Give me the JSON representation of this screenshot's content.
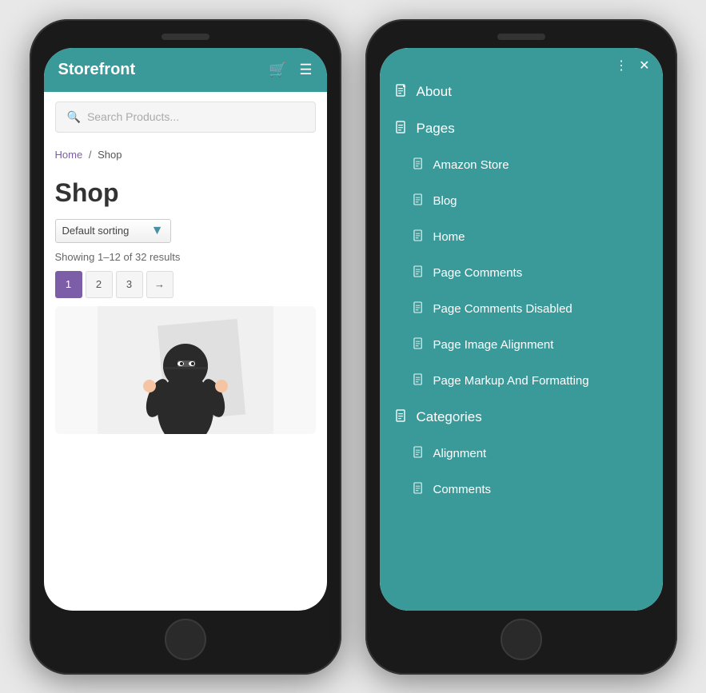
{
  "left_phone": {
    "header": {
      "logo": "Storefront",
      "cart_icon": "🛒",
      "menu_icon": "☰"
    },
    "search": {
      "placeholder": "Search Products..."
    },
    "breadcrumb": {
      "home": "Home",
      "separator": "/",
      "current": "Shop"
    },
    "shop": {
      "title": "Shop",
      "sort_label": "Default sorting",
      "results_text": "Showing 1–12 of 32 results",
      "pages": [
        "1",
        "2",
        "3",
        "→"
      ]
    }
  },
  "right_phone": {
    "top_items": [
      {
        "label": "About",
        "id": "about"
      }
    ],
    "nav_items": [
      {
        "label": "Pages",
        "level": "top",
        "id": "pages"
      },
      {
        "label": "Amazon Store",
        "level": "sub",
        "id": "amazon-store"
      },
      {
        "label": "Blog",
        "level": "sub",
        "id": "blog"
      },
      {
        "label": "Home",
        "level": "sub",
        "id": "home"
      },
      {
        "label": "Page Comments",
        "level": "sub",
        "id": "page-comments"
      },
      {
        "label": "Page Comments Disabled",
        "level": "sub",
        "id": "page-comments-disabled"
      },
      {
        "label": "Page Image Alignment",
        "level": "sub",
        "id": "page-image-alignment"
      },
      {
        "label": "Page Markup And Formatting",
        "level": "sub",
        "id": "page-markup"
      },
      {
        "label": "Categories",
        "level": "top",
        "id": "categories"
      },
      {
        "label": "Alignment",
        "level": "sub",
        "id": "alignment"
      },
      {
        "label": "Comments",
        "level": "sub",
        "id": "comments"
      }
    ],
    "icons": {
      "dots": "⋮",
      "close": "✕"
    },
    "accent_color": "#3a9a9a"
  }
}
